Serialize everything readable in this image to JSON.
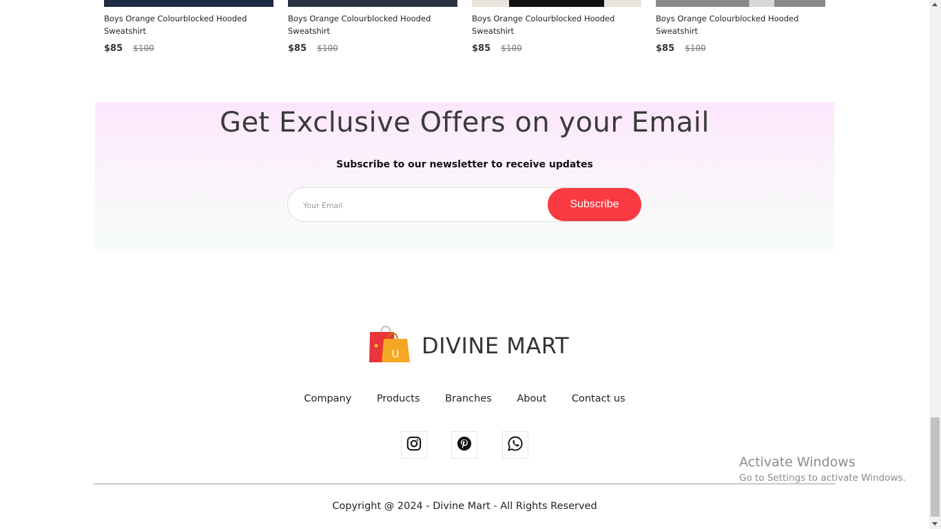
{
  "products": [
    {
      "name": "Boys Orange Colourblocked Hooded Sweatshirt",
      "price": "$85",
      "old_price": "$100",
      "image_color": "#1f2a44"
    },
    {
      "name": "Boys Orange Colourblocked Hooded Sweatshirt",
      "price": "$85",
      "old_price": "$100",
      "image_color": "#2b3445"
    },
    {
      "name": "Boys Orange Colourblocked Hooded Sweatshirt",
      "price": "$85",
      "old_price": "$100",
      "image_color": "#111111"
    },
    {
      "name": "Boys Orange Colourblocked Hooded Sweatshirt",
      "price": "$85",
      "old_price": "$100",
      "image_color": "#8a8a8a"
    }
  ],
  "newsletter": {
    "title": "Get Exclusive Offers on your Email",
    "subtitle": "Subscribe to our newsletter to receive updates",
    "placeholder": "Your Email",
    "button_label": "Subscribe"
  },
  "brand": {
    "name": "DIVINE MART",
    "logo_letter": "U"
  },
  "footer_nav": [
    "Company",
    "Products",
    "Branches",
    "About",
    "Contact us"
  ],
  "social": [
    "instagram-icon",
    "pinterest-icon",
    "whatsapp-icon"
  ],
  "copyright": "Copyright @ 2024 - Divine Mart - All Rights Reserved",
  "activate_windows": {
    "line1": "Activate Windows",
    "line2": "Go to Settings to activate Windows."
  },
  "colors": {
    "accent": "#f93a42"
  }
}
